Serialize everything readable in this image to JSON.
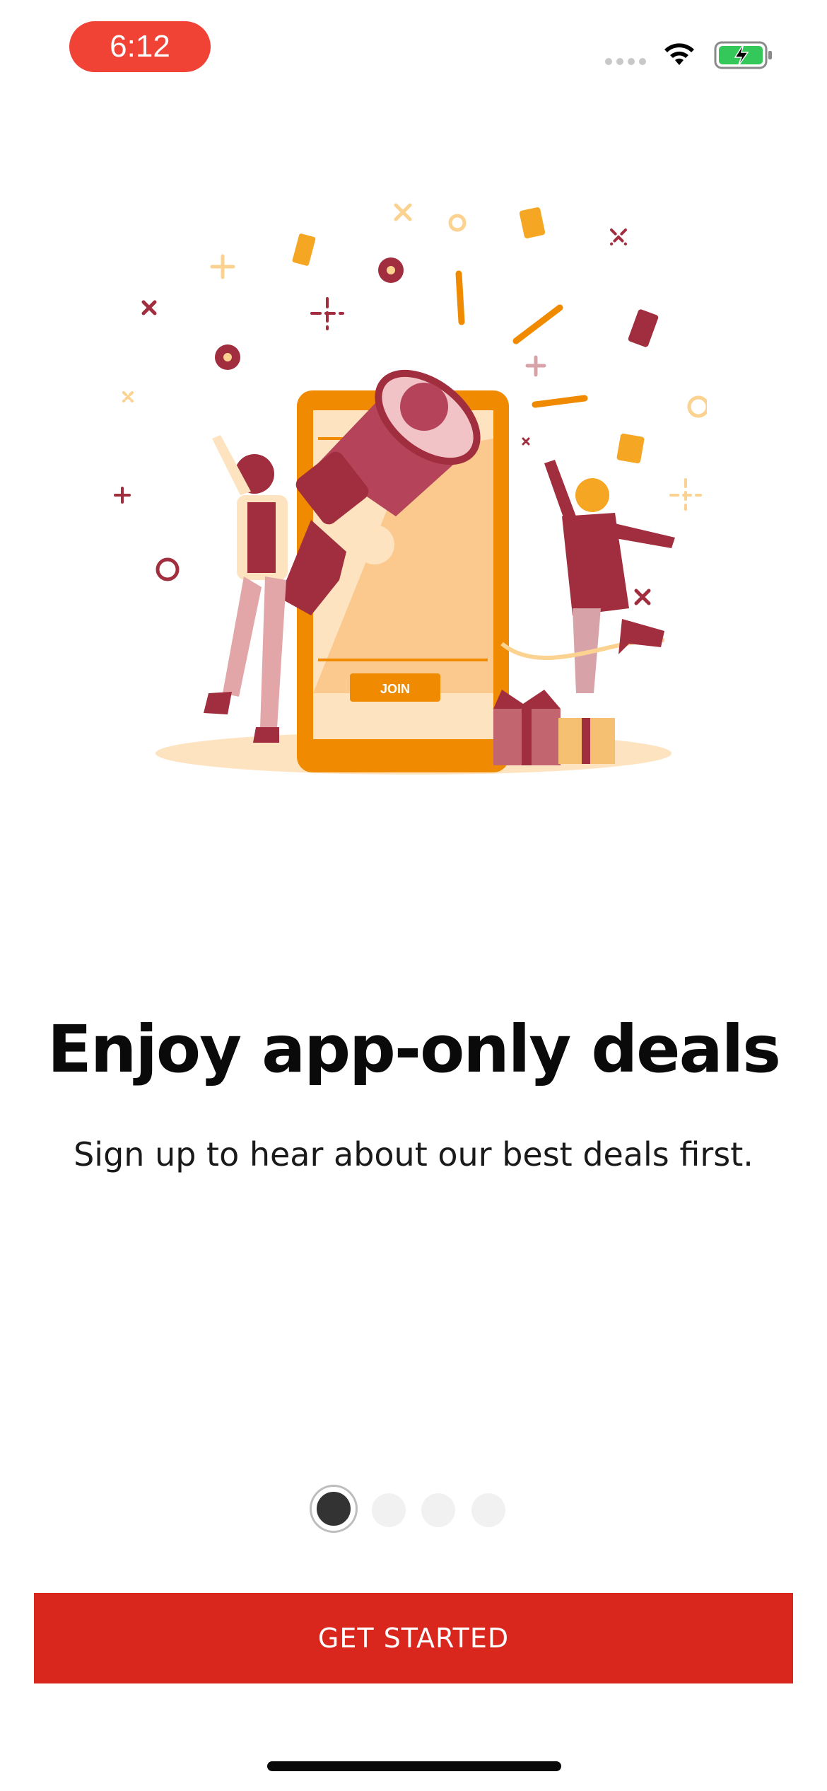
{
  "status_bar": {
    "time": "6:12",
    "time_pill_color": "#f04235",
    "wifi_icon": "wifi-icon",
    "battery_icon": "battery-charging-icon",
    "battery_color": "#34c759"
  },
  "illustration": {
    "icon": "megaphone-celebration-illustration",
    "join_label": "JOIN"
  },
  "onboarding": {
    "title": "Enjoy app-only deals",
    "subtitle": "Sign up to hear about our best deals first."
  },
  "pager": {
    "page_count": 4,
    "active_index": 0
  },
  "cta": {
    "label": "GET STARTED",
    "color": "#d9271e"
  }
}
